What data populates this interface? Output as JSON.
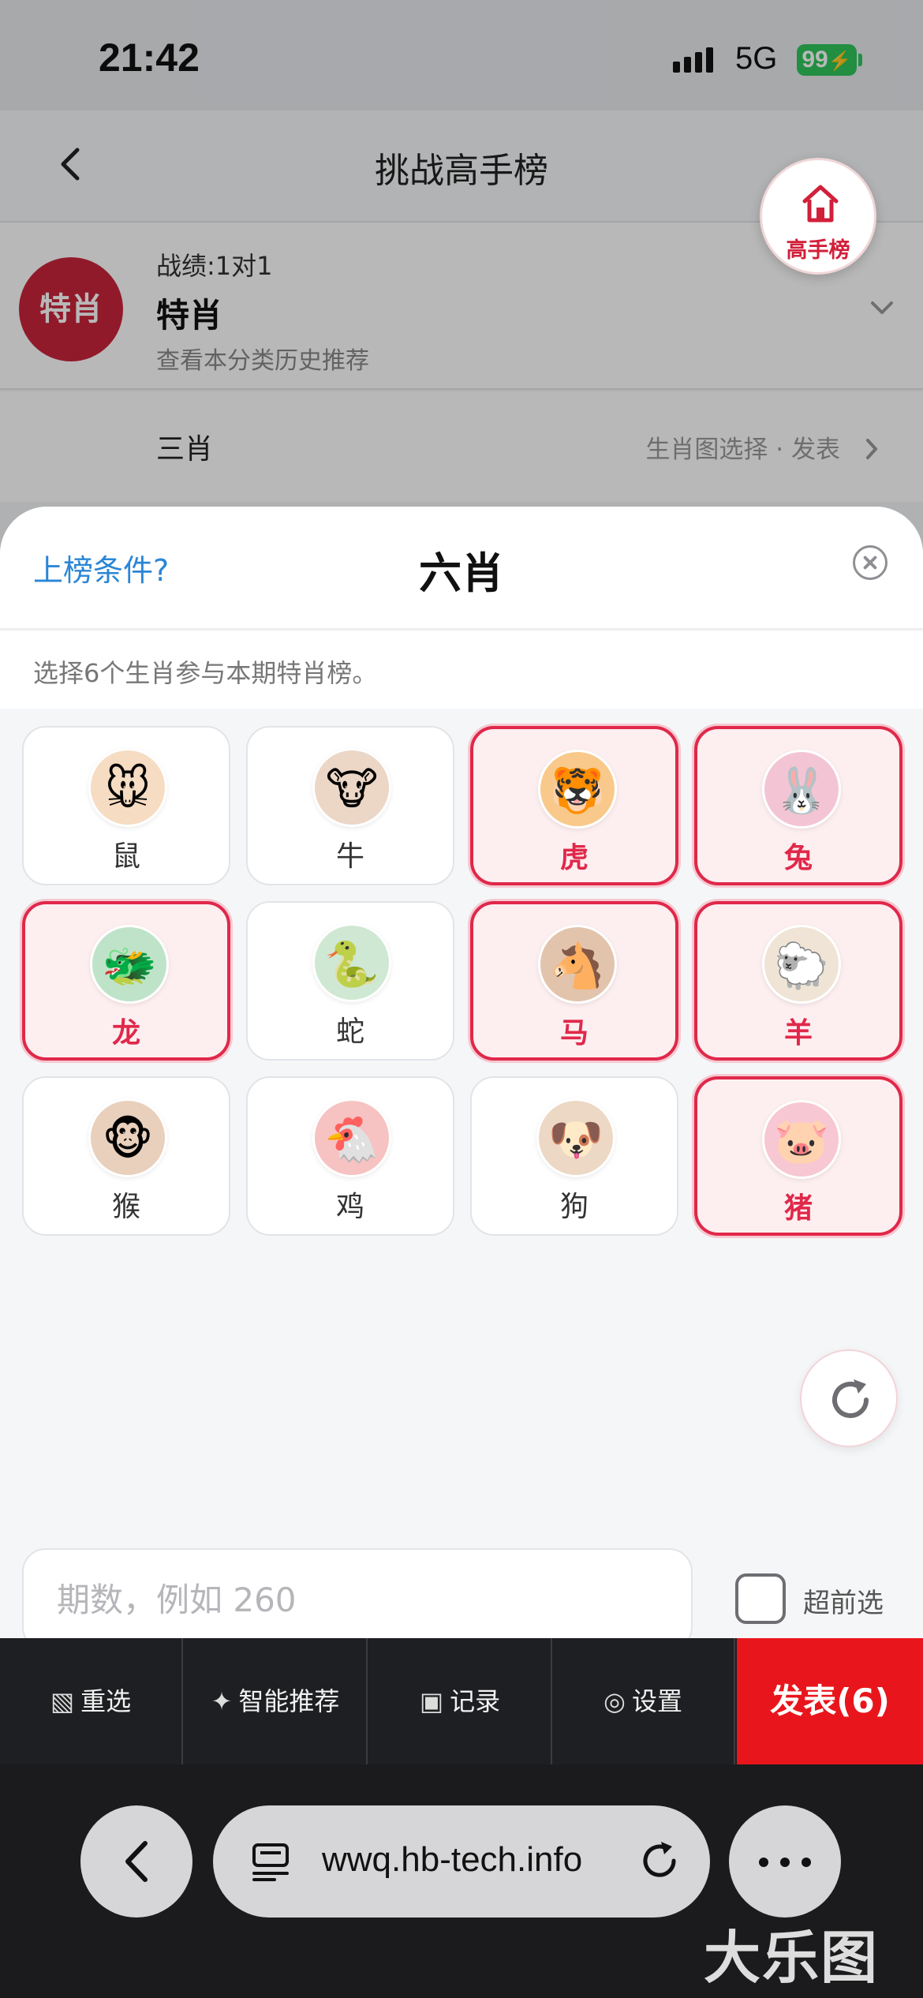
{
  "status": {
    "time": "21:42",
    "network": "5G",
    "battery": "99"
  },
  "nav": {
    "title": "挑战高手榜"
  },
  "home_badge": {
    "label": "高手榜"
  },
  "category": {
    "avatar_text": "特肖",
    "record": "战绩:1对1",
    "name": "特肖",
    "subtitle": "查看本分类历史推荐"
  },
  "category2": {
    "name": "三肖",
    "right_text": "生肖图选择 · 发表"
  },
  "sheet": {
    "conditions_link": "上榜条件?",
    "title": "六肖",
    "description": "选择6个生肖参与本期特肖榜。"
  },
  "zodiac": [
    {
      "label": "鼠",
      "emoji": "🐭",
      "selected": false,
      "bg": "#f6dcc2"
    },
    {
      "label": "牛",
      "emoji": "🐮",
      "selected": false,
      "bg": "#ecd6c6"
    },
    {
      "label": "虎",
      "emoji": "🐯",
      "selected": true,
      "bg": "#f8c98a"
    },
    {
      "label": "兔",
      "emoji": "🐰",
      "selected": true,
      "bg": "#f3c5d4"
    },
    {
      "label": "龙",
      "emoji": "🐲",
      "selected": true,
      "bg": "#bfe3c9"
    },
    {
      "label": "蛇",
      "emoji": "🐍",
      "selected": false,
      "bg": "#cfe8d3"
    },
    {
      "label": "马",
      "emoji": "🐴",
      "selected": true,
      "bg": "#e2c4ad"
    },
    {
      "label": "羊",
      "emoji": "🐑",
      "selected": true,
      "bg": "#efe4d5"
    },
    {
      "label": "猴",
      "emoji": "🐵",
      "selected": false,
      "bg": "#e8d0bc"
    },
    {
      "label": "鸡",
      "emoji": "🐔",
      "selected": false,
      "bg": "#f6c2c2"
    },
    {
      "label": "狗",
      "emoji": "🐶",
      "selected": false,
      "bg": "#ecd8c4"
    },
    {
      "label": "猪",
      "emoji": "🐷",
      "selected": true,
      "bg": "#f7c7d3"
    }
  ],
  "input": {
    "placeholder": "期数，例如 260",
    "value": ""
  },
  "advance": {
    "label": "超前选",
    "checked": false
  },
  "actions": [
    {
      "icon": "▧",
      "label": "重选"
    },
    {
      "icon": "✦",
      "label": "智能推荐"
    },
    {
      "icon": "▣",
      "label": "记录"
    },
    {
      "icon": "◎",
      "label": "设置"
    }
  ],
  "publish": {
    "label": "发表(6)"
  },
  "browser": {
    "url": "wwq.hb-tech.info",
    "watermark": "大乐图"
  },
  "colors": {
    "accent_red": "#e0284a",
    "publish_red": "#e8161c",
    "link_blue": "#2a86d6"
  }
}
